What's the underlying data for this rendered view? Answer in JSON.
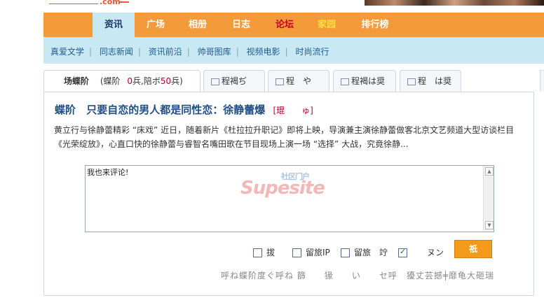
{
  "logo": {
    "text": ".com"
  },
  "nav": {
    "items": [
      {
        "label": "资讯",
        "style": "active"
      },
      {
        "label": "广场",
        "style": ""
      },
      {
        "label": "相册",
        "style": ""
      },
      {
        "label": "日志",
        "style": ""
      },
      {
        "label": "论坛",
        "style": "red"
      },
      {
        "label": "家园",
        "style": "yellow"
      },
      {
        "label": "排行榜",
        "style": ""
      }
    ]
  },
  "subnav": {
    "items": [
      "真爱文学",
      "同志新闻",
      "资讯前沿",
      "帅哥图库",
      "视频电影",
      "时尚流行"
    ]
  },
  "tabs": [
    {
      "label": "场蝶阶",
      "extra": "(蝶阶",
      "count1": "0",
      "mid": "兵,陪ボ",
      "count2": "50",
      "end": "兵)"
    },
    {
      "label": "程褐ぢ"
    },
    {
      "label": "程　や"
    },
    {
      "label": "程褐は奨"
    },
    {
      "label": "程　は奨"
    }
  ],
  "article": {
    "prefix": "蝶阶",
    "title": "只要自恋的男人都是同性恋：徐静蕾爆",
    "tag": "[琨　　ゅ]",
    "summary": "黄立行与徐静蕾精彩 “床戏” 近日，随着新片《杜拉拉升职记》即将上映，导演兼主演徐静蕾做客北京文艺频道大型访谈栏目《光荣绽放》，心直口快的徐静蕾与睿智名嘴田歌在节目现场上演一场 “选择” 大战，究竟徐静..."
  },
  "comment": {
    "placeholder": "我也来评论!",
    "watermark": "Supesite",
    "watermark_sub": "社区门户"
  },
  "options": [
    {
      "label": "拔",
      "checked": false
    },
    {
      "label": "留旅IP",
      "checked": false
    },
    {
      "label": "留旅　竚",
      "checked": true
    },
    {
      "label": "ヌン",
      "checked": false
    }
  ],
  "submit_label": "祇",
  "footer_text": "呼ね蝶阶度ぐ呼ね 篩　　猭　　い　　セ呼　獶丈芸撼╪靡龟大砸瑞"
}
